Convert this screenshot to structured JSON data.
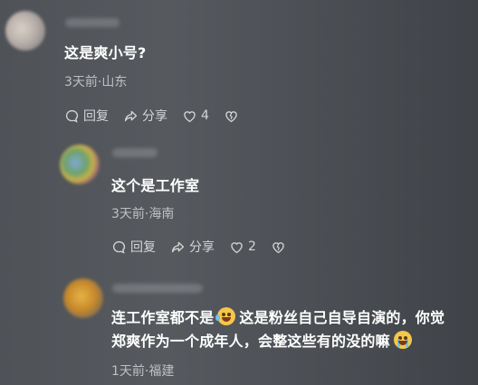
{
  "comments": [
    {
      "content": "这是爽小号?",
      "meta": "3天前·山东",
      "reply_label": "回复",
      "share_label": "分享",
      "like_count": "4"
    },
    {
      "content": "这个是工作室",
      "meta": "3天前·海南",
      "reply_label": "回复",
      "share_label": "分享",
      "like_count": "2"
    },
    {
      "content_line1_a": "连工作室都不是",
      "content_line1_b": "这是粉丝自己自导自演的，你觉",
      "content_line2": "郑爽作为一个成年人，会整这些有的没的嘛",
      "meta": "1天前·福建"
    }
  ],
  "icons": {
    "reply": "reply-icon",
    "share": "share-icon",
    "like": "heart-icon",
    "dislike": "broken-heart-icon",
    "emoji1": "laughing-tears-emoji",
    "emoji2": "crying-emoji"
  }
}
